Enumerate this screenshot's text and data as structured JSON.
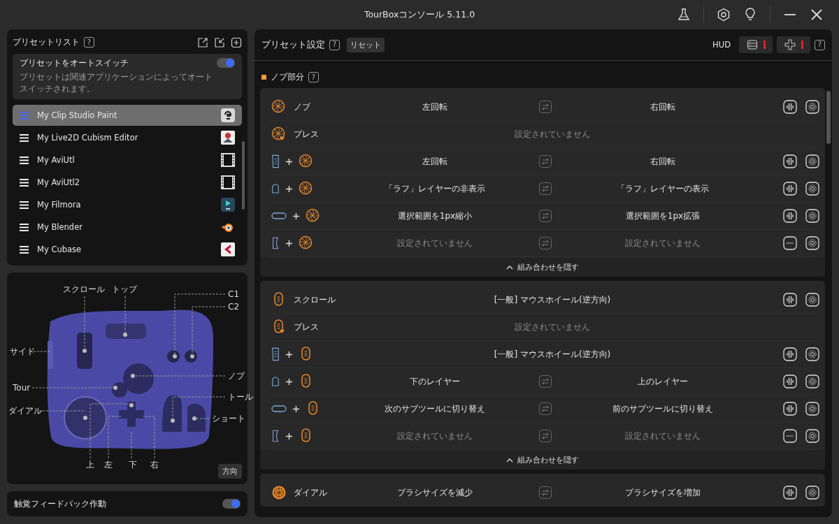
{
  "window": {
    "title": "TourBoxコンソール 5.11.0"
  },
  "preset_list": {
    "title": "プリセットリスト",
    "help": "?",
    "auto_switch": {
      "label": "プリセットをオートスイッチ",
      "description": "プリセットは関連アプリケーションによってオートスイッチされます。",
      "on": true
    },
    "items": [
      {
        "name": "My Clip Studio Paint",
        "kind": "swirl",
        "selected": true
      },
      {
        "name": "My Live2D Cubism Editor",
        "kind": "figure",
        "selected": false
      },
      {
        "name": "My AviUtl",
        "kind": "film",
        "selected": false
      },
      {
        "name": "My AviUtl2",
        "kind": "film",
        "selected": false
      },
      {
        "name": "My Filmora",
        "kind": "ribbon",
        "selected": false
      },
      {
        "name": "My Blender",
        "kind": "orb",
        "selected": false
      },
      {
        "name": "My Cubase",
        "kind": "chevron",
        "selected": false
      }
    ]
  },
  "device": {
    "labels": [
      "スクロール",
      "トップ",
      "C1",
      "C2",
      "サイド",
      "ノブ",
      "Tour",
      "トール",
      "ダイアル",
      "ショート",
      "上",
      "左",
      "下",
      "右"
    ],
    "direction_button": "方向"
  },
  "haptic": {
    "label": "触覚フィードバック作動",
    "on": true
  },
  "settings": {
    "title": "プリセット設定",
    "help": "?",
    "reset": "リセット",
    "hud": {
      "label": "HUD",
      "help": "?",
      "buttons": [
        {
          "kind": "list",
          "enabled": false
        },
        {
          "kind": "dpad",
          "enabled": false
        }
      ]
    },
    "section": {
      "label": "ノブ部分",
      "help": "?"
    },
    "groups": [
      {
        "footer": "組み合わせを隠す",
        "rows": [
          {
            "kind": "pair",
            "icons": [
              {
                "kind": "knob"
              }
            ],
            "label": "ノブ",
            "left": "左回転",
            "right": "右回転",
            "assigned": true,
            "haptic": true
          },
          {
            "kind": "press",
            "icons": [
              {
                "kind": "knob_press"
              }
            ],
            "label": "プレス",
            "text": "設定されていません",
            "assigned": false
          },
          {
            "kind": "pair",
            "icons": [
              {
                "kind": "lined"
              },
              {
                "kind": "plus"
              },
              {
                "kind": "knob"
              }
            ],
            "left": "左回転",
            "right": "右回転",
            "assigned": true,
            "haptic": true
          },
          {
            "kind": "pair",
            "icons": [
              {
                "kind": "arch"
              },
              {
                "kind": "plus"
              },
              {
                "kind": "knob"
              }
            ],
            "left": "「ラフ」レイヤーの非表示",
            "right": "「ラフ」レイヤーの表示",
            "assigned": true,
            "haptic": true
          },
          {
            "kind": "pair",
            "icons": [
              {
                "kind": "pill"
              },
              {
                "kind": "plus"
              },
              {
                "kind": "knob"
              }
            ],
            "left": "選択範囲を1px縮小",
            "right": "選択範囲を1px拡張",
            "assigned": true,
            "haptic": true
          },
          {
            "kind": "pair",
            "icons": [
              {
                "kind": "bracket"
              },
              {
                "kind": "plus"
              },
              {
                "kind": "knob"
              }
            ],
            "left": "設定されていません",
            "right": "設定されていません",
            "assigned": false,
            "haptic": false
          }
        ]
      },
      {
        "footer": "組み合わせを隠す",
        "rows": [
          {
            "kind": "single",
            "icons": [
              {
                "kind": "scroll"
              }
            ],
            "label": "スクロール",
            "text": "[一般] マウスホイール(逆方向)",
            "assigned": true,
            "haptic": true
          },
          {
            "kind": "press",
            "icons": [
              {
                "kind": "scroll_press"
              }
            ],
            "label": "プレス",
            "text": "設定されていません",
            "assigned": false
          },
          {
            "kind": "single",
            "icons": [
              {
                "kind": "lined"
              },
              {
                "kind": "plus"
              },
              {
                "kind": "scroll"
              }
            ],
            "text": "[一般] マウスホイール(逆方向)",
            "assigned": true,
            "haptic": true
          },
          {
            "kind": "pair",
            "icons": [
              {
                "kind": "arch"
              },
              {
                "kind": "plus"
              },
              {
                "kind": "scroll"
              }
            ],
            "left": "下のレイヤー",
            "right": "上のレイヤー",
            "assigned": true,
            "haptic": true
          },
          {
            "kind": "pair",
            "icons": [
              {
                "kind": "pill"
              },
              {
                "kind": "plus"
              },
              {
                "kind": "scroll"
              }
            ],
            "left": "次のサブツールに切り替え",
            "right": "前のサブツールに切り替え",
            "assigned": true,
            "haptic": true
          },
          {
            "kind": "pair",
            "icons": [
              {
                "kind": "bracket"
              },
              {
                "kind": "plus"
              },
              {
                "kind": "scroll"
              }
            ],
            "left": "設定されていません",
            "right": "設定されていません",
            "assigned": false,
            "haptic": false
          }
        ]
      },
      {
        "rows": [
          {
            "kind": "pair",
            "icons": [
              {
                "kind": "dial"
              }
            ],
            "label": "ダイアル",
            "left": "ブラシサイズを減少",
            "right": "ブラシサイズを増加",
            "assigned": true,
            "haptic": true
          }
        ]
      }
    ]
  }
}
